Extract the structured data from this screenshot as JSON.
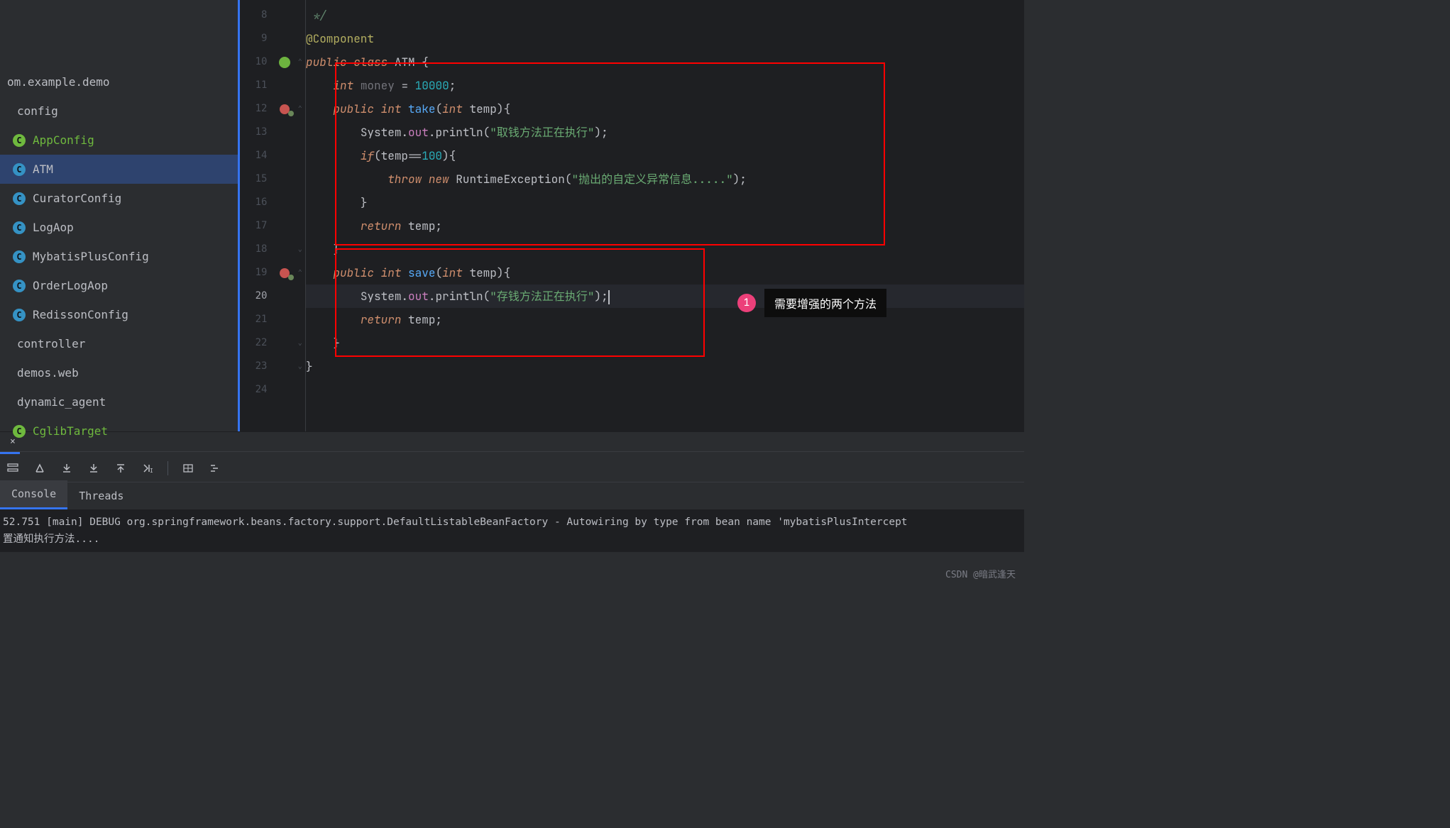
{
  "sidebar": {
    "package": "om.example.demo",
    "folders": [
      "config",
      "controller",
      "demos.web",
      "dynamic_agent"
    ],
    "config_items": [
      {
        "label": "AppConfig",
        "green": true
      },
      {
        "label": "ATM",
        "selected": true,
        "green": false
      },
      {
        "label": "CuratorConfig",
        "green": false
      },
      {
        "label": "LogAop",
        "green": false
      },
      {
        "label": "MybatisPlusConfig",
        "green": false
      },
      {
        "label": "OrderLogAop",
        "green": false
      },
      {
        "label": "RedissonConfig",
        "green": false
      }
    ],
    "dynamic_items": [
      {
        "label": "CglibTarget",
        "green": true
      }
    ]
  },
  "editor": {
    "line_start": 8,
    "current_line": 20,
    "lines": {
      "l8": {
        "comment_close": "*/"
      },
      "l9": {
        "annotation": "@Component"
      },
      "l10": {
        "kw1": "public",
        "kw2": "class",
        "cls": "ATM",
        "brace": "{"
      },
      "l11": {
        "kw": "int",
        "field": "money",
        "eq": "=",
        "num": "10000",
        "semi": ";"
      },
      "l12": {
        "kw1": "public",
        "kw2": "int",
        "method": "take",
        "kw3": "int",
        "param": "temp",
        "brace": "){"
      },
      "l13": {
        "obj": "System",
        "dot1": ".",
        "field": "out",
        "dot2": ".",
        "method": "println",
        "str": "\"取钱方法正在执行\"",
        "end": ");"
      },
      "l14": {
        "kw": "if",
        "cond": "(temp==",
        "num": "100",
        "brace": "){"
      },
      "l15": {
        "kw1": "throw",
        "kw2": "new",
        "cls": "RuntimeException",
        "str": "\"抛出的自定义异常信息.....\"",
        "end": ");"
      },
      "l16": {
        "brace": "}"
      },
      "l17": {
        "kw": "return",
        "var": "temp;"
      },
      "l18": {
        "brace": "}"
      },
      "l19": {
        "kw1": "public",
        "kw2": "int",
        "method": "save",
        "kw3": "int",
        "param": "temp",
        "brace": "){"
      },
      "l20": {
        "obj": "System",
        "dot1": ".",
        "field": "out",
        "dot2": ".",
        "method": "println",
        "str": "\"存钱方法正在执行\"",
        "end": ");"
      },
      "l21": {
        "kw": "return",
        "var": "temp;"
      },
      "l22": {
        "brace": "}"
      },
      "l23": {
        "brace": "}"
      }
    }
  },
  "annotation": {
    "num": "1",
    "text": "需要增强的两个方法"
  },
  "console": {
    "tabs": [
      "Console",
      "Threads"
    ],
    "active_tab": "Console",
    "log_line1": "52.751 [main] DEBUG org.springframework.beans.factory.support.DefaultListableBeanFactory - Autowiring by type from bean name 'mybatisPlusIntercept",
    "log_line2": "置通知执行方法...."
  },
  "watermark": "CSDN @暗武逢天"
}
